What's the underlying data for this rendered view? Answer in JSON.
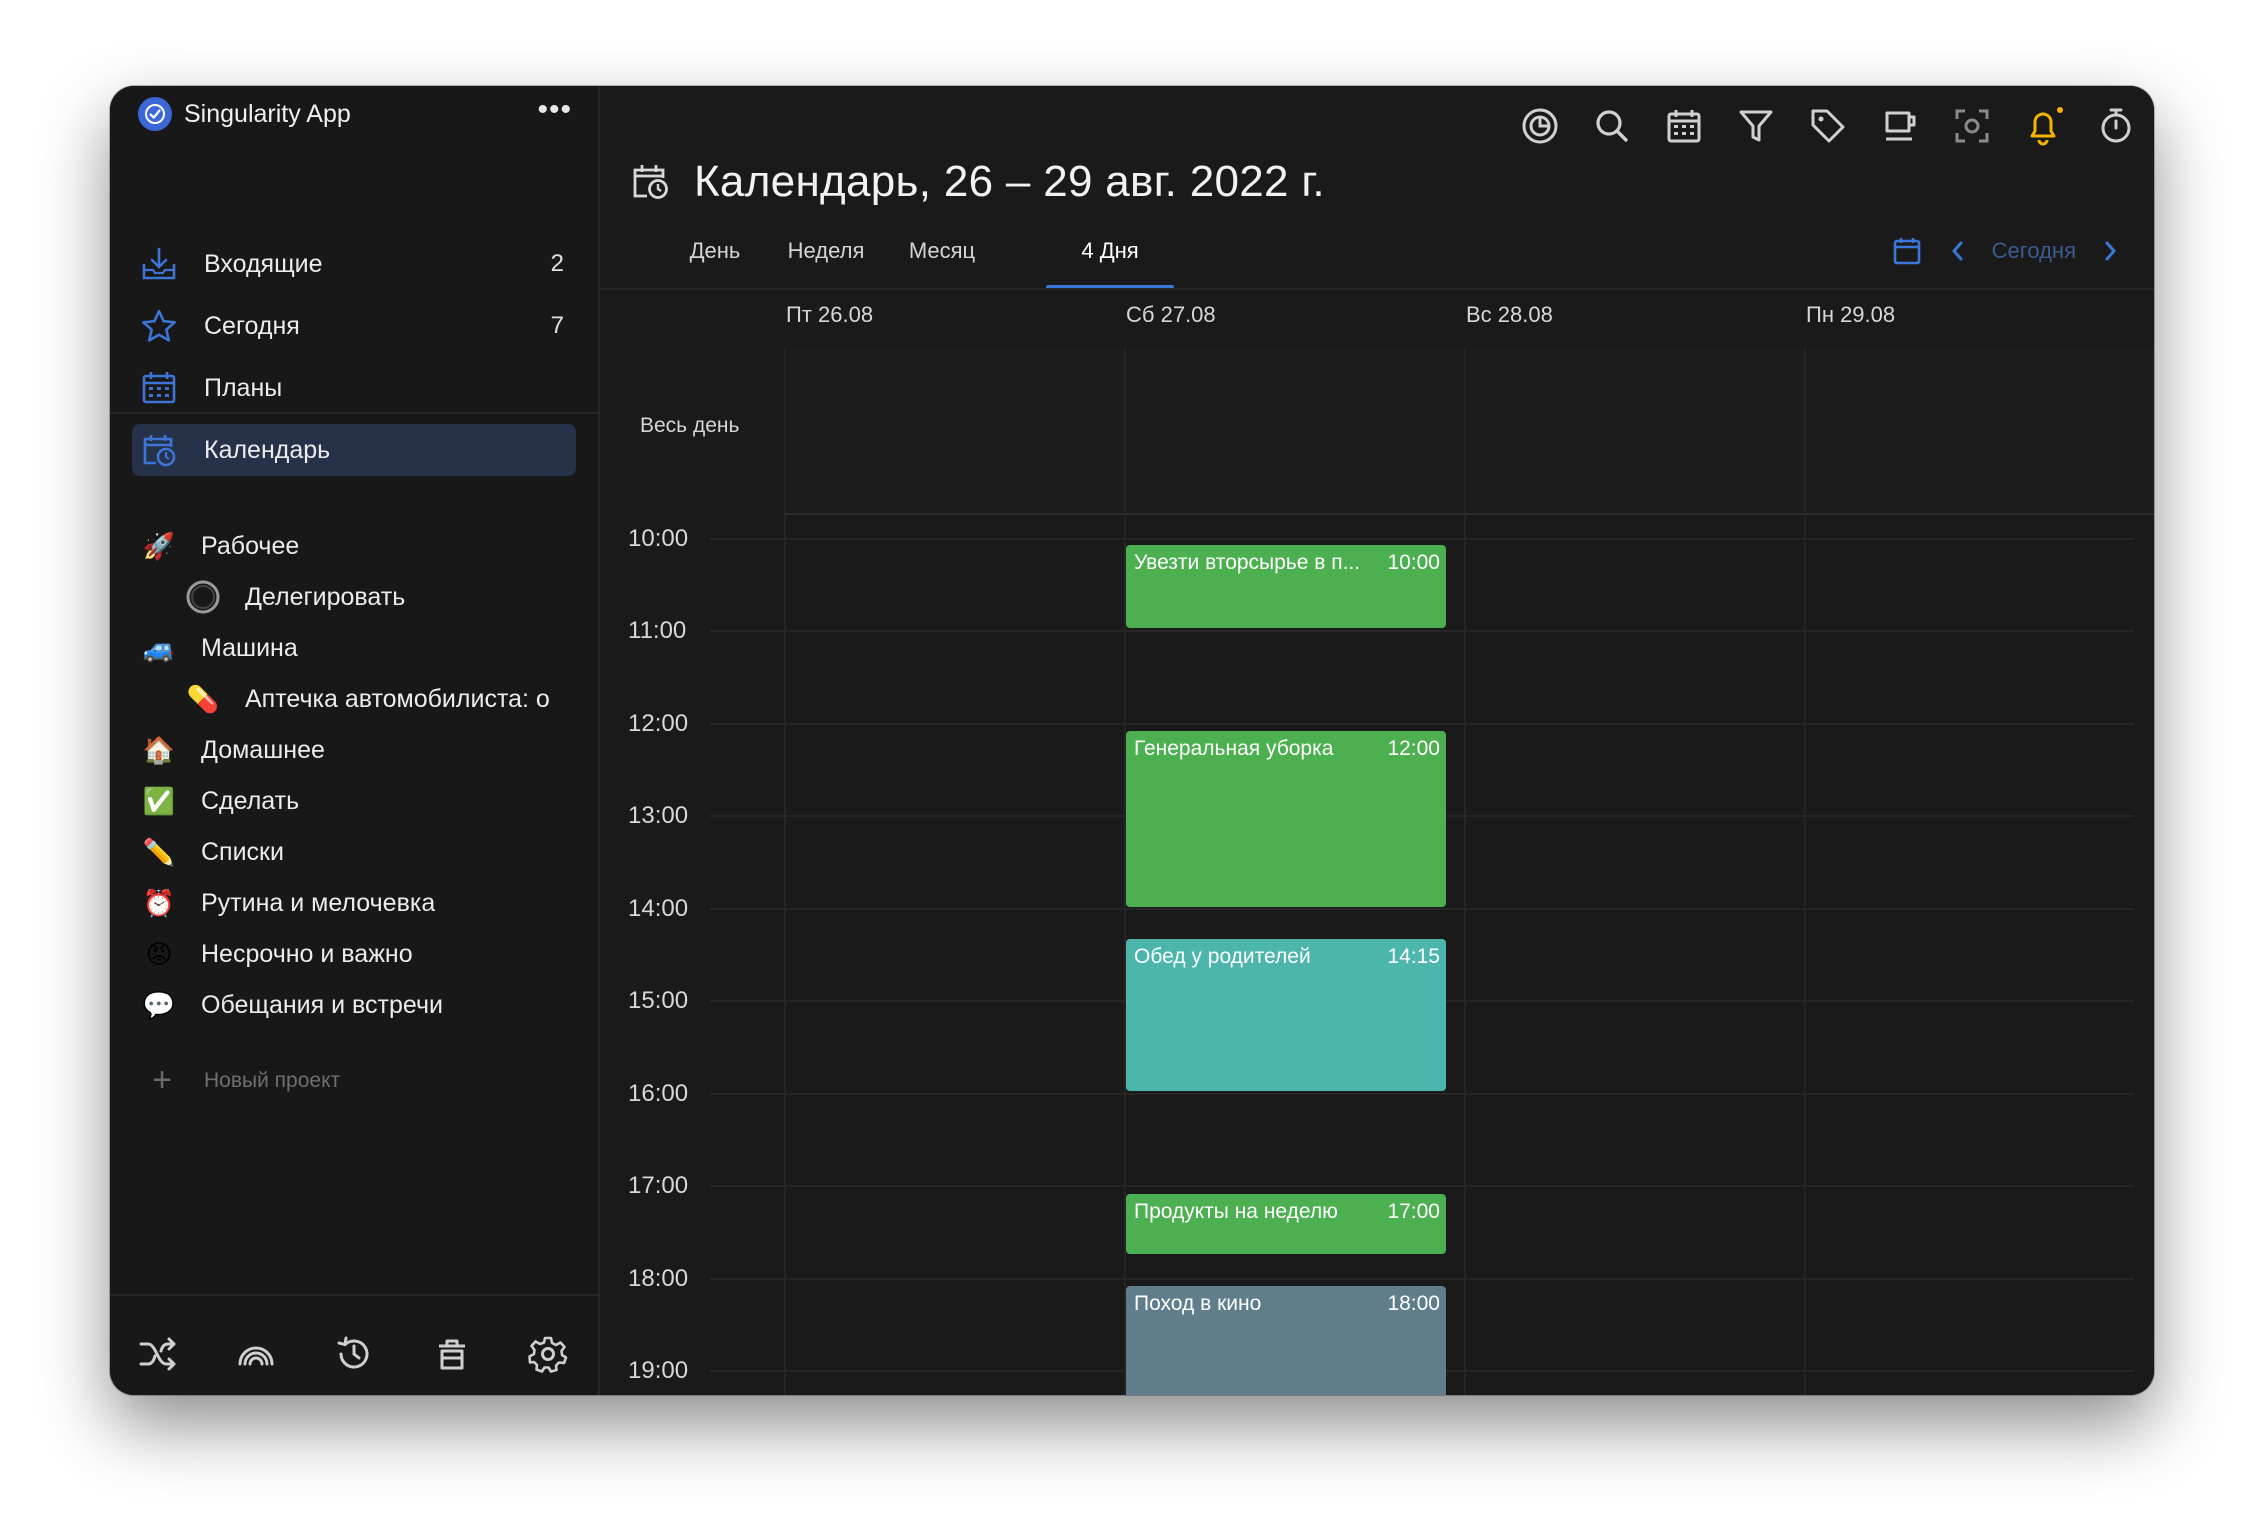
{
  "app": {
    "name": "Singularity App",
    "more_icon": "more-horizontal-icon"
  },
  "sidebar": {
    "nav": [
      {
        "label": "Входящие",
        "count": "2",
        "icon": "inbox-icon"
      },
      {
        "label": "Сегодня",
        "count": "7",
        "icon": "star-icon"
      },
      {
        "label": "Планы",
        "count": "",
        "icon": "calendar-grid-icon"
      },
      {
        "label": "Календарь",
        "count": "",
        "icon": "calendar-clock-icon",
        "active": true
      }
    ],
    "projects": [
      {
        "label": "Рабочее",
        "icon": "rocket-icon",
        "emoji": "🚀"
      },
      {
        "label": "Делегировать",
        "icon": "circle-icon",
        "emoji": ""
      },
      {
        "label": "Машина",
        "icon": "car-icon",
        "emoji": "🚙"
      },
      {
        "label": "Аптечка автомобилиста: о",
        "icon": "pill-icon",
        "emoji": "💊"
      },
      {
        "label": "Домашнее",
        "icon": "house-icon",
        "emoji": "🏠"
      },
      {
        "label": "Сделать",
        "icon": "check-box-icon",
        "emoji": "✅"
      },
      {
        "label": "Списки",
        "icon": "pencil-icon",
        "emoji": "✏️"
      },
      {
        "label": "Рутина и мелочевка",
        "icon": "alarm-clock-icon",
        "emoji": "⏰"
      },
      {
        "label": "Несрочно и важно",
        "icon": "angry-face-icon",
        "emoji": "😡"
      },
      {
        "label": "Обещания и встречи",
        "icon": "speech-bubble-icon",
        "emoji": "💬"
      }
    ],
    "new_project": "Новый проект",
    "footer_icons": [
      "shuffle-icon",
      "rainbow-icon",
      "history-icon",
      "trash-icon",
      "settings-icon"
    ]
  },
  "toolbar": {
    "icons": [
      "focus-icon",
      "search-icon",
      "calendar-icon",
      "filter-icon",
      "tag-icon",
      "coffee-icon",
      "screenshot-icon",
      "bell-icon",
      "timer-icon"
    ]
  },
  "header": {
    "title": "Календарь, 26 – 29 авг. 2022 г."
  },
  "tabs": [
    {
      "label": "День"
    },
    {
      "label": "Неделя"
    },
    {
      "label": "Месяц"
    },
    {
      "label": "4 Дня",
      "active": true
    }
  ],
  "date_nav": {
    "today": "Сегодня"
  },
  "calendar": {
    "days": [
      "Пт 26.08",
      "Сб 27.08",
      "Вс 28.08",
      "Пн 29.08"
    ],
    "all_day_label": "Весь день",
    "hours": [
      "10:00",
      "11:00",
      "12:00",
      "13:00",
      "14:00",
      "15:00",
      "16:00",
      "17:00",
      "18:00",
      "19:00"
    ],
    "events": [
      {
        "title": "Увезти вторсырье в п...",
        "time": "10:00",
        "color": "#4caf50",
        "day": "Сб 27.08"
      },
      {
        "title": "Генеральная уборка",
        "time": "12:00",
        "color": "#4caf50",
        "day": "Сб 27.08"
      },
      {
        "title": "Обед у родителей",
        "time": "14:15",
        "color": "#4db6ac",
        "day": "Сб 27.08"
      },
      {
        "title": "Продукты на неделю",
        "time": "17:00",
        "color": "#4caf50",
        "day": "Сб 27.08"
      },
      {
        "title": "Поход в кино",
        "time": "18:00",
        "color": "#607d8b",
        "day": "Сб 27.08"
      }
    ]
  },
  "colors": {
    "accent": "#3a78d8",
    "bell": "#f5b400",
    "active_nav_bg": "#26324a"
  }
}
